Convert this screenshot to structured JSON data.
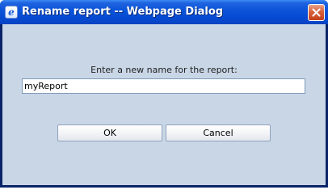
{
  "window": {
    "title": "Rename report -- Webpage Dialog",
    "icon": "ie-icon",
    "icon_glyph": "e",
    "close_icon": "close-icon"
  },
  "dialog": {
    "prompt": "Enter a new name for the report:",
    "report_name_value": "myReport",
    "ok_label": "OK",
    "cancel_label": "Cancel"
  },
  "colors": {
    "titlebar": "#0a53d8",
    "client_background": "#c9d6e6",
    "close_button": "#d95f3c"
  }
}
